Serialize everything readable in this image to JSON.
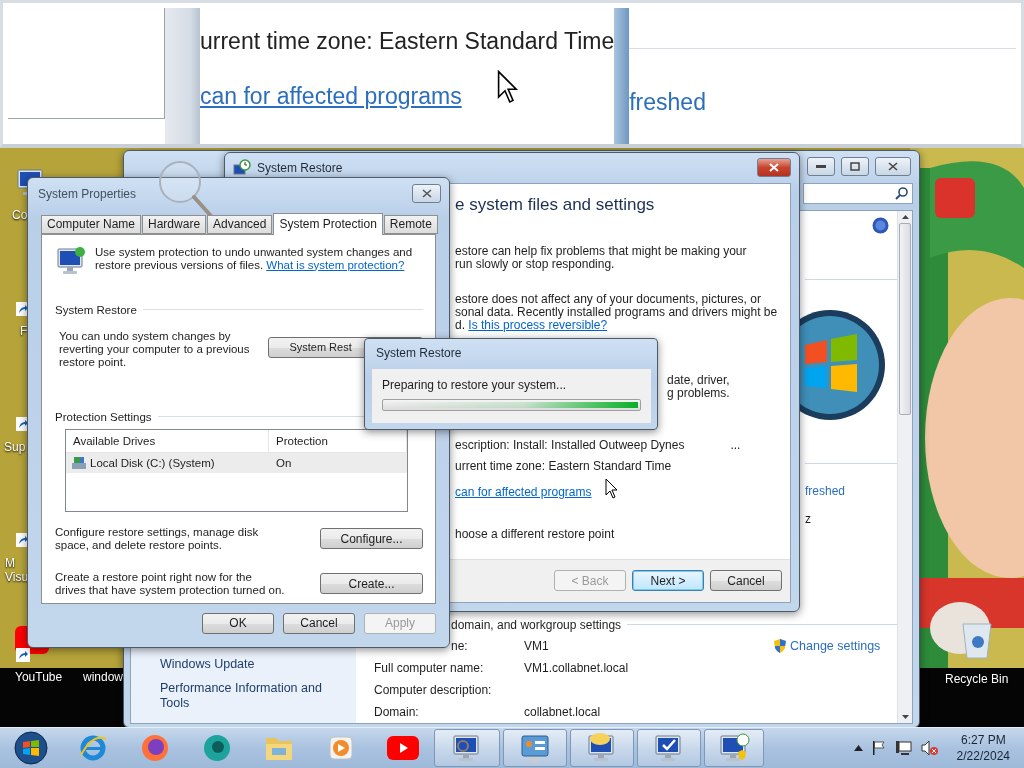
{
  "magnifier": {
    "line": "urrent time zone: Eastern Standard Time",
    "link": "can for affected programs",
    "side_link": "freshed"
  },
  "desktop_icons": [
    {
      "lines": [
        "Co"
      ]
    },
    {
      "lines": [
        "F"
      ]
    },
    {
      "lines": [
        "Sup"
      ]
    },
    {
      "lines": [
        "M",
        "Visu"
      ]
    },
    {
      "lines": [
        "YouTube"
      ]
    },
    {
      "lines": [
        "window"
      ]
    }
  ],
  "recycle_bin": {
    "label": "Recycle Bin"
  },
  "system_window": {
    "nav": [
      "Windows Update",
      "Performance Information and Tools"
    ],
    "side_link": "freshed",
    "side_text": "z",
    "section": "domain, and workgroup settings",
    "change_settings": "Change settings",
    "rows": [
      {
        "label": "ne:",
        "value": "VM1",
        "clipped": true
      },
      {
        "label": "Full computer name:",
        "value": "VM1.collabnet.local",
        "clipped": false
      },
      {
        "label": "Computer description:",
        "clipped": false
      },
      {
        "label": "Domain:",
        "value": "collabnet.local",
        "clipped": false
      }
    ]
  },
  "wizard": {
    "title": "System Restore",
    "heading": "e system files and settings",
    "paragraphs": [
      {
        "lines": [
          "estore can help fix problems that might be making your",
          " run slowly or stop responding."
        ]
      },
      {
        "lines": [
          "estore does not affect any of your documents, pictures, or",
          "sonal data. Recently installed programs and drivers might be",
          "d."
        ],
        "link": "Is this process reversible?"
      }
    ],
    "covered_paragraph": {
      "lines": [
        "date, driver,",
        "g problems."
      ]
    },
    "description": "escription: Install: Installed Outweep Dynes",
    "ellipsis": "...",
    "timezone": "urrent time zone: Eastern Standard Time",
    "scan_link": "can for affected programs",
    "choose": "hoose a different restore point",
    "buttons": [
      {
        "label": "< Back",
        "disabled": true,
        "default": false
      },
      {
        "label": "Next >",
        "disabled": false,
        "default": true
      },
      {
        "label": "Cancel",
        "disabled": false,
        "default": false
      }
    ]
  },
  "system_properties": {
    "title": "System Properties",
    "tabs": [
      {
        "label": "Computer Name",
        "selected": false
      },
      {
        "label": "Hardware",
        "selected": false
      },
      {
        "label": "Advanced",
        "selected": false
      },
      {
        "label": "System Protection",
        "selected": true
      },
      {
        "label": "Remote",
        "selected": false
      }
    ],
    "intro": "Use system protection to undo unwanted system changes and restore previous versions of files.",
    "intro_link": "What is system protection?",
    "restore_group": "System Restore",
    "restore_text": "You can undo system changes by reverting your computer to a previous restore point.",
    "restore_button": "System Rest",
    "protection_group": "Protection Settings",
    "columns": [
      "Available Drives",
      "Protection"
    ],
    "drives": [
      {
        "name": "Local Disk (C:) (System)",
        "protection": "On",
        "selected": true
      }
    ],
    "configure_text": "Configure restore settings, manage disk space, and delete restore points.",
    "configure_button": "Configure...",
    "create_text": "Create a restore point right now for the drives that have system protection turned on.",
    "create_button": "Create...",
    "buttons": [
      {
        "label": "OK",
        "disabled": false
      },
      {
        "label": "Cancel",
        "disabled": false
      },
      {
        "label": "Apply",
        "disabled": true
      }
    ]
  },
  "progress": {
    "title": "System Restore",
    "message": "Preparing to restore your system...",
    "level": 1
  },
  "taskbar": {
    "time": "6:27 PM",
    "date": "2/22/2024"
  }
}
